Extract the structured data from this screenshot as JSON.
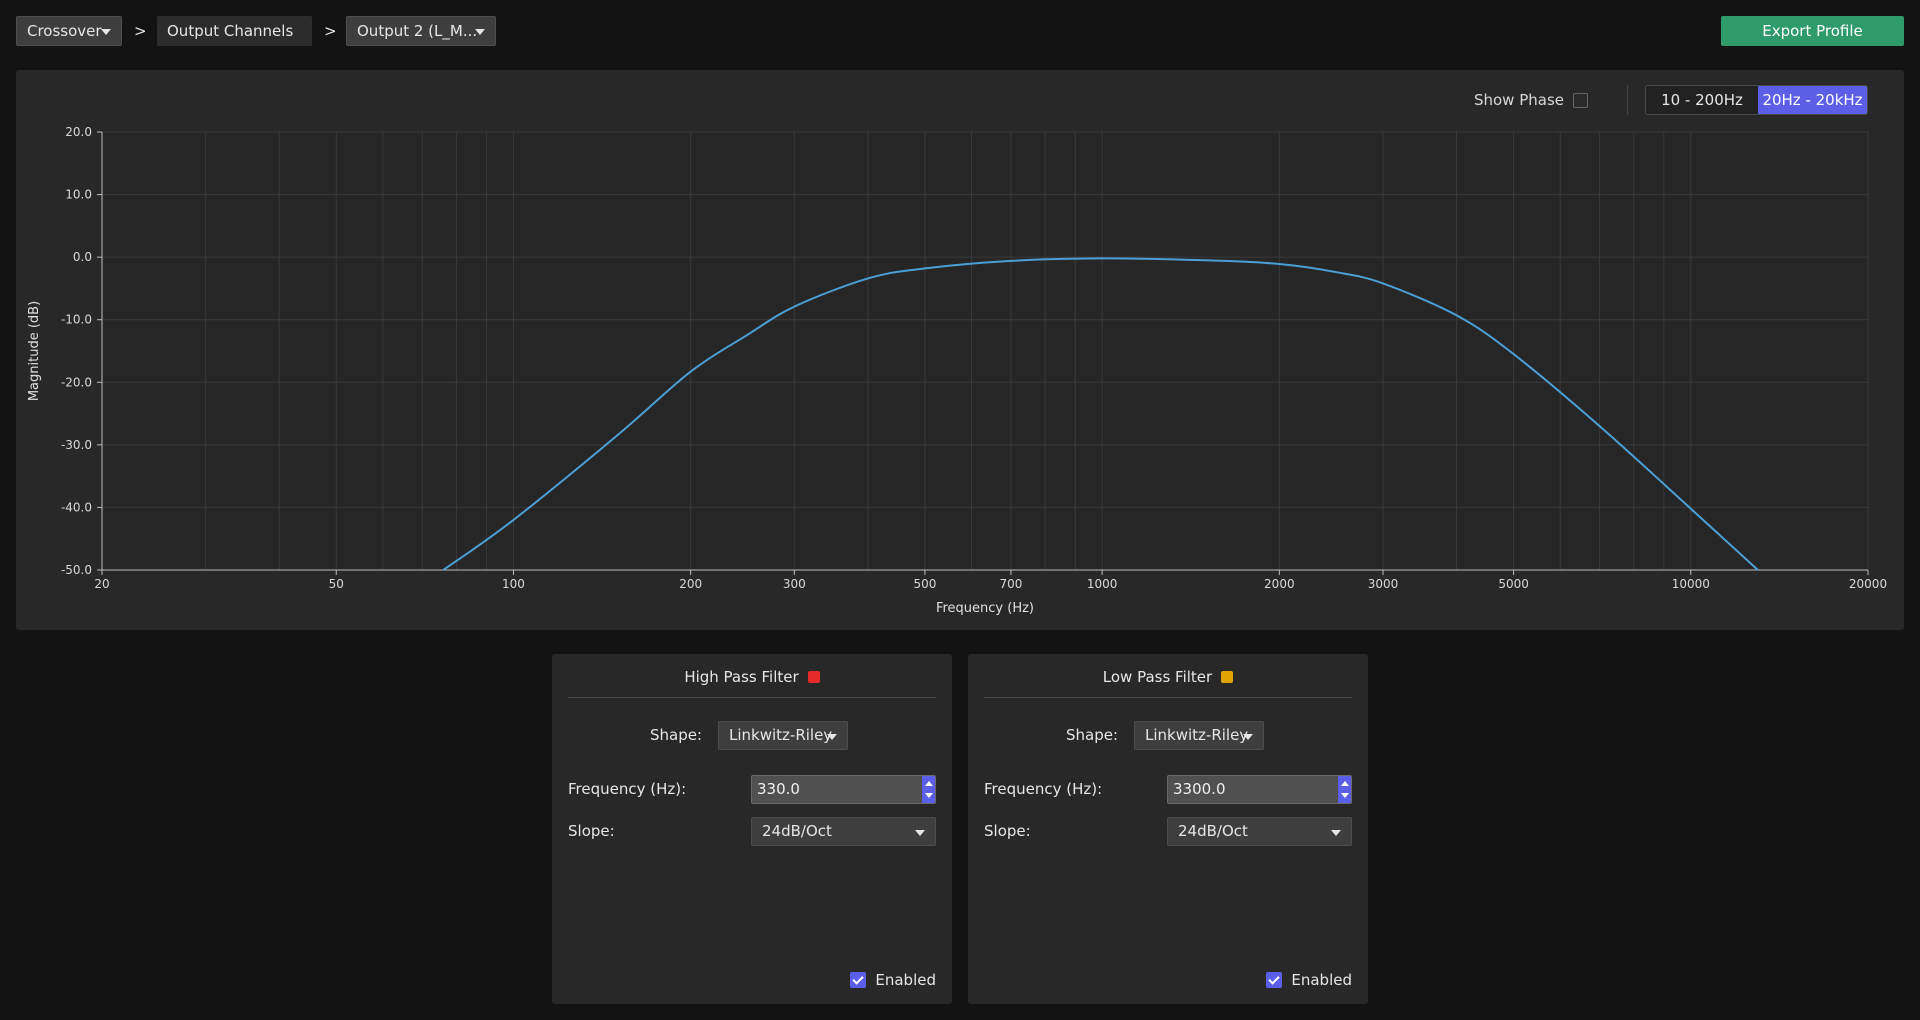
{
  "breadcrumb": {
    "mode_label": "Crossover",
    "separator": ">",
    "section_label": "Output Channels",
    "channel_label": "Output 2 (L_M..."
  },
  "export_label": "Export Profile",
  "chart_controls": {
    "show_phase_label": "Show Phase",
    "show_phase_checked": false,
    "ranges": [
      "10 - 200Hz",
      "20Hz - 20kHz"
    ],
    "active_range": "20Hz - 20kHz"
  },
  "chart_data": {
    "type": "line",
    "xlabel": "Frequency (Hz)",
    "ylabel": "Magnitude (dB)",
    "x_scale": "log",
    "xlim": [
      20,
      20000
    ],
    "ylim": [
      -50,
      20
    ],
    "x_ticks": [
      20,
      50,
      100,
      200,
      300,
      500,
      700,
      1000,
      2000,
      3000,
      5000,
      10000,
      20000
    ],
    "y_ticks": [
      "20.0",
      "10.0",
      "0.0",
      "-10.0",
      "-20.0",
      "-30.0",
      "-40.0",
      "-50.0"
    ],
    "grid": true,
    "line_color": "#4a9fd6",
    "series": [
      {
        "x": [
          76,
          100,
          150,
          200,
          250,
          300,
          400,
          500,
          700,
          1000,
          1500,
          2000,
          2500,
          3000,
          4000,
          5000,
          7000,
          10000,
          13000
        ],
        "y": [
          -50,
          -42,
          -28.5,
          -18.3,
          -12.4,
          -7.9,
          -3.4,
          -1.8,
          -0.6,
          -0.2,
          -0.5,
          -1.1,
          -2.4,
          -4.2,
          -9.3,
          -15.5,
          -27,
          -40.2,
          -50
        ]
      }
    ]
  },
  "high_pass": {
    "title": "High Pass Filter",
    "color": "#e62a2a",
    "shape_label": "Shape:",
    "shape_value": "Linkwitz-Riley",
    "freq_label": "Frequency (Hz):",
    "freq_value": "330.0",
    "slope_label": "Slope:",
    "slope_value": "24dB/Oct",
    "enabled_label": "Enabled",
    "enabled": true
  },
  "low_pass": {
    "title": "Low Pass Filter",
    "color": "#e0a400",
    "shape_label": "Shape:",
    "shape_value": "Linkwitz-Riley",
    "freq_label": "Frequency (Hz):",
    "freq_value": "3300.0",
    "slope_label": "Slope:",
    "slope_value": "24dB/Oct",
    "enabled_label": "Enabled",
    "enabled": true
  }
}
